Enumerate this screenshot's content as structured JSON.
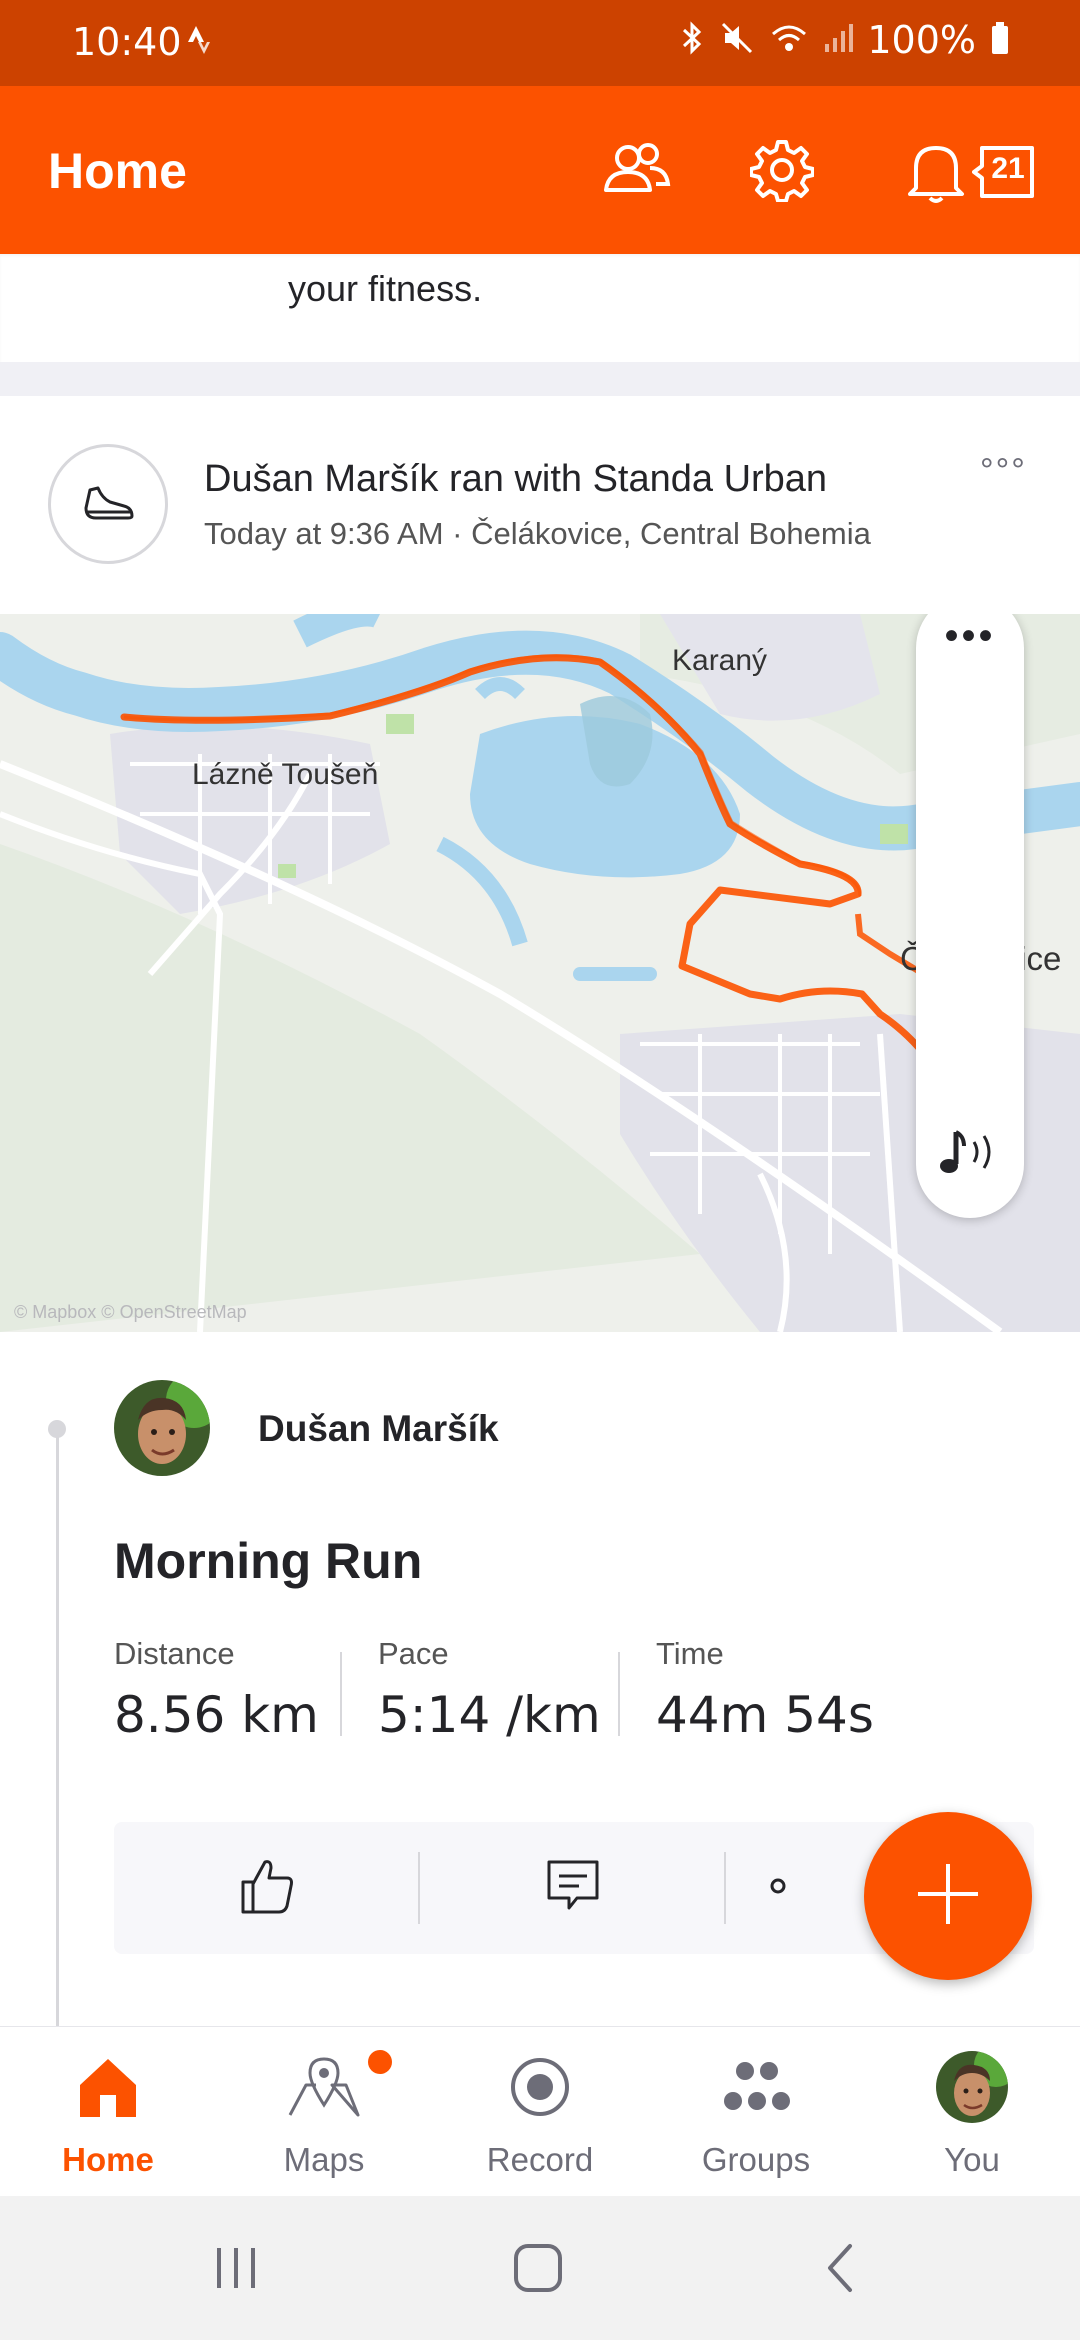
{
  "status_bar": {
    "time": "10:40",
    "battery": "100%"
  },
  "header": {
    "title": "Home",
    "notification_count": "21"
  },
  "previous_card": {
    "text_tail": "your fitness."
  },
  "activity": {
    "headline": "Dušan Maršík ran with Standa Urban",
    "subline": "Today at 9:36 AM · Čelákovice, Central Bohemia",
    "more_label": "°°°",
    "map": {
      "labels": {
        "karany": "Karaný",
        "lazne": "Lázně Toušeň",
        "celakovice": "Čelákovice"
      },
      "credit": "© Mapbox © OpenStreetMap",
      "route_color": "#fc5200",
      "water_color": "#aad5ee"
    },
    "athlete_name": "Dušan Maršík",
    "title": "Morning Run",
    "stats": [
      {
        "label": "Distance",
        "value": "8.56 km"
      },
      {
        "label": "Pace",
        "value": "5:14 /km"
      },
      {
        "label": "Time",
        "value": "44m 54s"
      }
    ]
  },
  "bottom_nav": [
    {
      "label": "Home",
      "active": true
    },
    {
      "label": "Maps",
      "active": false
    },
    {
      "label": "Record",
      "active": false
    },
    {
      "label": "Groups",
      "active": false
    },
    {
      "label": "You",
      "active": false
    }
  ],
  "colors": {
    "brand": "#fc5200",
    "status_bar": "#cc4200"
  }
}
